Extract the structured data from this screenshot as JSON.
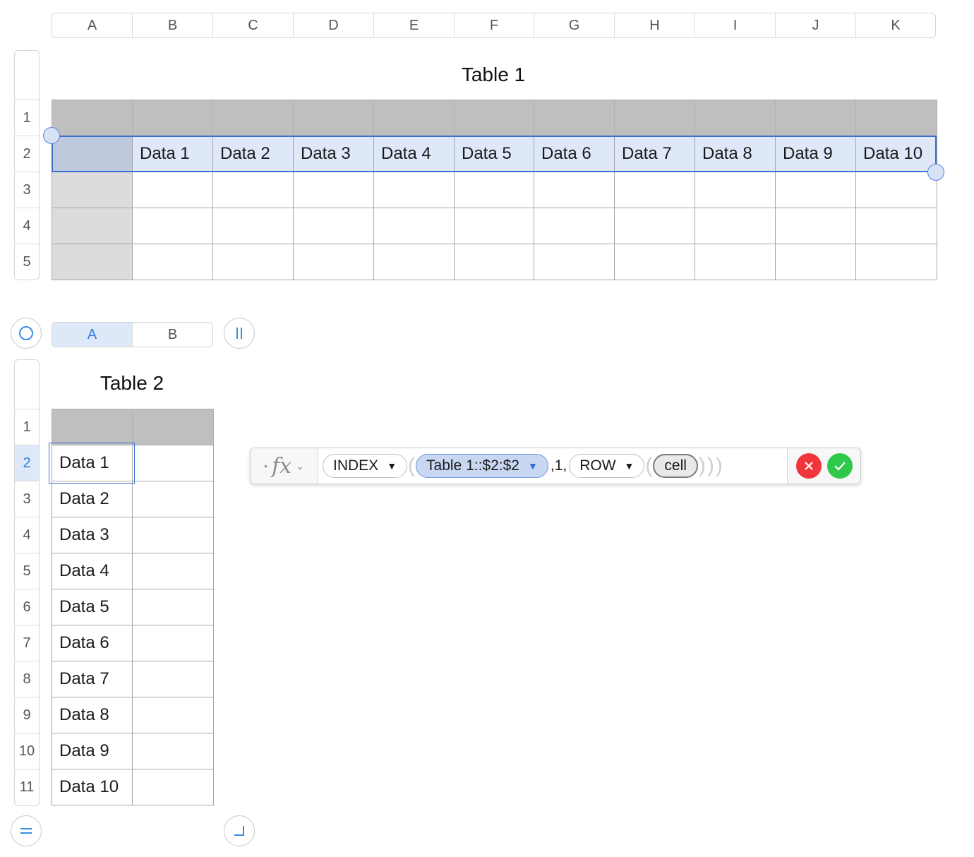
{
  "table1": {
    "title": "Table 1",
    "columns": [
      "A",
      "B",
      "C",
      "D",
      "E",
      "F",
      "G",
      "H",
      "I",
      "J",
      "K"
    ],
    "rows": [
      "1",
      "2",
      "3",
      "4",
      "5"
    ],
    "row2_values": [
      "",
      "Data 1",
      "Data 2",
      "Data 3",
      "Data 4",
      "Data 5",
      "Data 6",
      "Data 7",
      "Data 8",
      "Data 9",
      "Data 10"
    ]
  },
  "table2": {
    "title": "Table 2",
    "columns": [
      "A",
      "B"
    ],
    "active_column": "A",
    "rows": [
      "1",
      "2",
      "3",
      "4",
      "5",
      "6",
      "7",
      "8",
      "9",
      "10",
      "11"
    ],
    "active_row": "2",
    "col_a_values": [
      "Data 1",
      "Data 2",
      "Data 3",
      "Data 4",
      "Data 5",
      "Data 6",
      "Data 7",
      "Data 8",
      "Data 9",
      "Data 10"
    ]
  },
  "formula": {
    "fx_label": "fx",
    "function": "INDEX",
    "reference": "Table 1::$2:$2",
    "separator": ",1,",
    "nested_function": "ROW",
    "argument": "cell"
  },
  "icons": {
    "cancel": "close-icon",
    "accept": "checkmark-icon",
    "dropdown": "triangle-down-icon"
  },
  "colors": {
    "selection": "#3b6fcb",
    "header_fill": "#bfbfbf",
    "cancel": "#f0363d",
    "accept": "#2fc94a"
  }
}
